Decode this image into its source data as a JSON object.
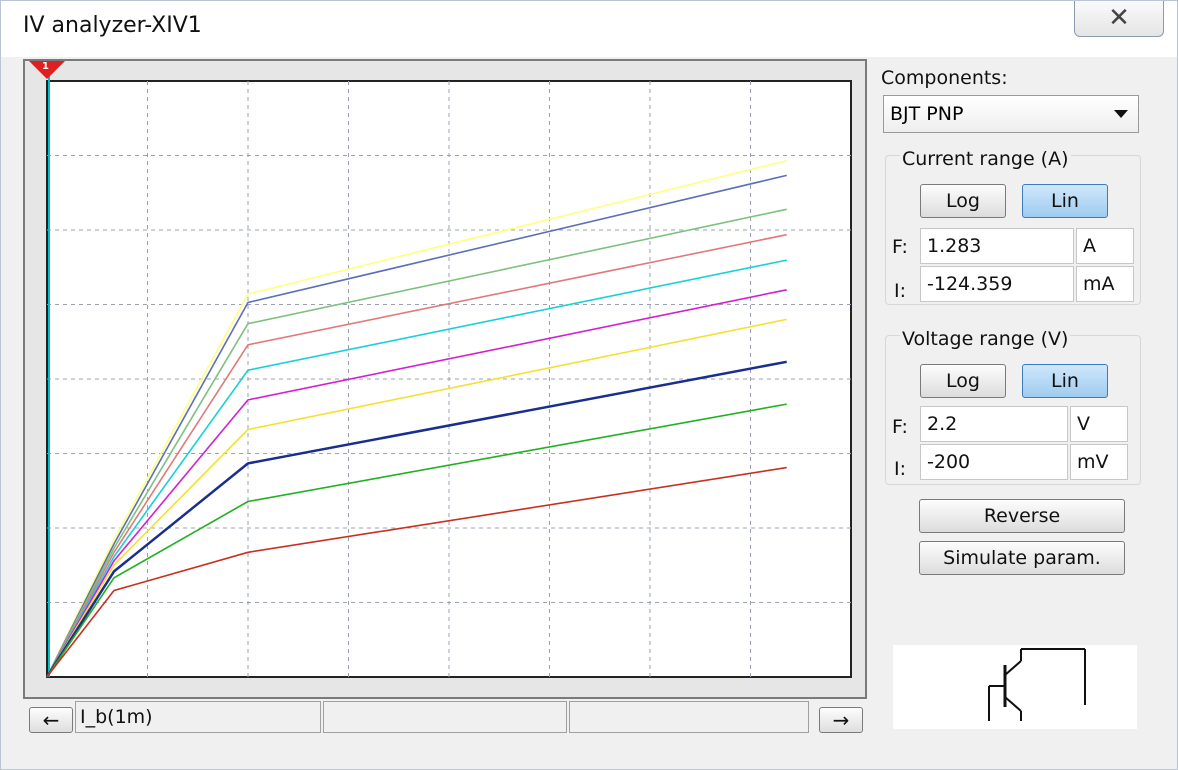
{
  "window": {
    "title": "IV analyzer-XIV1",
    "close_glyph": "✕"
  },
  "graph": {
    "background": "#ffffff",
    "grid_color": "#9aa0b0",
    "cursor_color": "#00c0d0",
    "cursor_marker": "1",
    "traces": [
      {
        "color": "#ffff80"
      },
      {
        "color": "#5a6fb8"
      },
      {
        "color": "#7ec07e"
      },
      {
        "color": "#e07a7a"
      },
      {
        "color": "#18d0d8"
      },
      {
        "color": "#d020d0"
      },
      {
        "color": "#f5e030"
      },
      {
        "color": "#1a2e90"
      },
      {
        "color": "#20b020"
      },
      {
        "color": "#c83020"
      }
    ]
  },
  "chart_data": {
    "type": "line",
    "title": "",
    "xlabel": "",
    "ylabel": "",
    "xlim": [
      -0.2,
      2.2
    ],
    "ylim": [
      -124.359,
      1283
    ],
    "grid": true,
    "series": [
      {
        "x": [
          -0.2,
          0.0,
          0.4,
          2.2
        ],
        "y": [
          -124,
          200,
          780,
          1095
        ]
      },
      {
        "x": [
          -0.2,
          0.0,
          0.4,
          2.2
        ],
        "y": [
          -124,
          190,
          760,
          1060
        ]
      },
      {
        "x": [
          -0.2,
          0.0,
          0.4,
          2.2
        ],
        "y": [
          -124,
          180,
          710,
          980
        ]
      },
      {
        "x": [
          -0.2,
          0.0,
          0.4,
          2.2
        ],
        "y": [
          -124,
          170,
          660,
          920
        ]
      },
      {
        "x": [
          -0.2,
          0.0,
          0.4,
          2.2
        ],
        "y": [
          -124,
          160,
          600,
          860
        ]
      },
      {
        "x": [
          -0.2,
          0.0,
          0.4,
          2.2
        ],
        "y": [
          -124,
          150,
          530,
          790
        ]
      },
      {
        "x": [
          -0.2,
          0.0,
          0.4,
          2.2
        ],
        "y": [
          -124,
          140,
          460,
          720
        ]
      },
      {
        "x": [
          -0.2,
          0.0,
          0.4,
          2.2
        ],
        "y": [
          -124,
          125,
          380,
          620
        ]
      },
      {
        "x": [
          -0.2,
          0.0,
          0.4,
          2.2
        ],
        "y": [
          -124,
          110,
          290,
          520
        ]
      },
      {
        "x": [
          -0.2,
          0.0,
          0.4,
          2.2
        ],
        "y": [
          -124,
          80,
          170,
          370
        ]
      }
    ]
  },
  "bottom": {
    "left_arrow": "←",
    "right_arrow": "→",
    "trace_label": "I_b(1m)"
  },
  "panel": {
    "components_label": "Components:",
    "component_selected": "BJT PNP",
    "current_range": {
      "title": "Current range (A)",
      "log_label": "Log",
      "lin_label": "Lin",
      "f_label": "F:",
      "f_value": "1.283",
      "f_unit": "A",
      "i_label": "I:",
      "i_value": "-124.359",
      "i_unit": "mA"
    },
    "voltage_range": {
      "title": "Voltage range (V)",
      "log_label": "Log",
      "lin_label": "Lin",
      "f_label": "F:",
      "f_value": "2.2",
      "f_unit": "V",
      "i_label": "I:",
      "i_value": "-200",
      "i_unit": "mV"
    },
    "reverse_label": "Reverse",
    "simulate_label": "Simulate param."
  }
}
